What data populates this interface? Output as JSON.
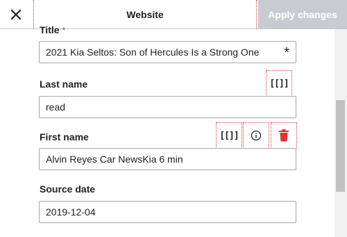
{
  "header": {
    "close_icon": "close-icon",
    "title": "Website",
    "apply_label": "Apply changes"
  },
  "fields": {
    "title": {
      "label": "Title",
      "value": "2021 Kia Seltos: Son of Hercules Is a Strong One",
      "required_mark": "*"
    },
    "last_name": {
      "label": "Last name",
      "value": "read",
      "wikitext_button": "[[]]"
    },
    "first_name": {
      "label": "First name",
      "value": "Alvin Reyes Car NewsKia 6 min",
      "wikitext_button": "[[]]",
      "info_icon": "info-icon",
      "delete_icon": "trash-icon"
    },
    "source_date": {
      "label": "Source date",
      "value": "2019-12-04"
    }
  },
  "colors": {
    "apply_disabled_bg": "#c8ccd1",
    "delete_red": "#d33",
    "border": "#a2a9b1"
  }
}
